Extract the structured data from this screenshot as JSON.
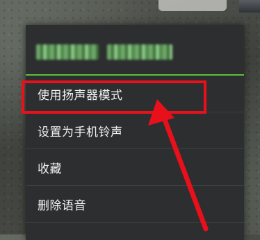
{
  "menu": {
    "header_name": "",
    "items": [
      {
        "label": "使用扬声器模式"
      },
      {
        "label": "设置为手机铃声"
      },
      {
        "label": "收藏"
      },
      {
        "label": "删除语音"
      }
    ]
  },
  "annotation": {
    "color": "#e8101a",
    "highlighted_item": "使用扬声器模式"
  },
  "colors": {
    "menu_bg": "#2c2e30",
    "header_line": "#5fbf3a",
    "text": "#f2f2f2"
  }
}
